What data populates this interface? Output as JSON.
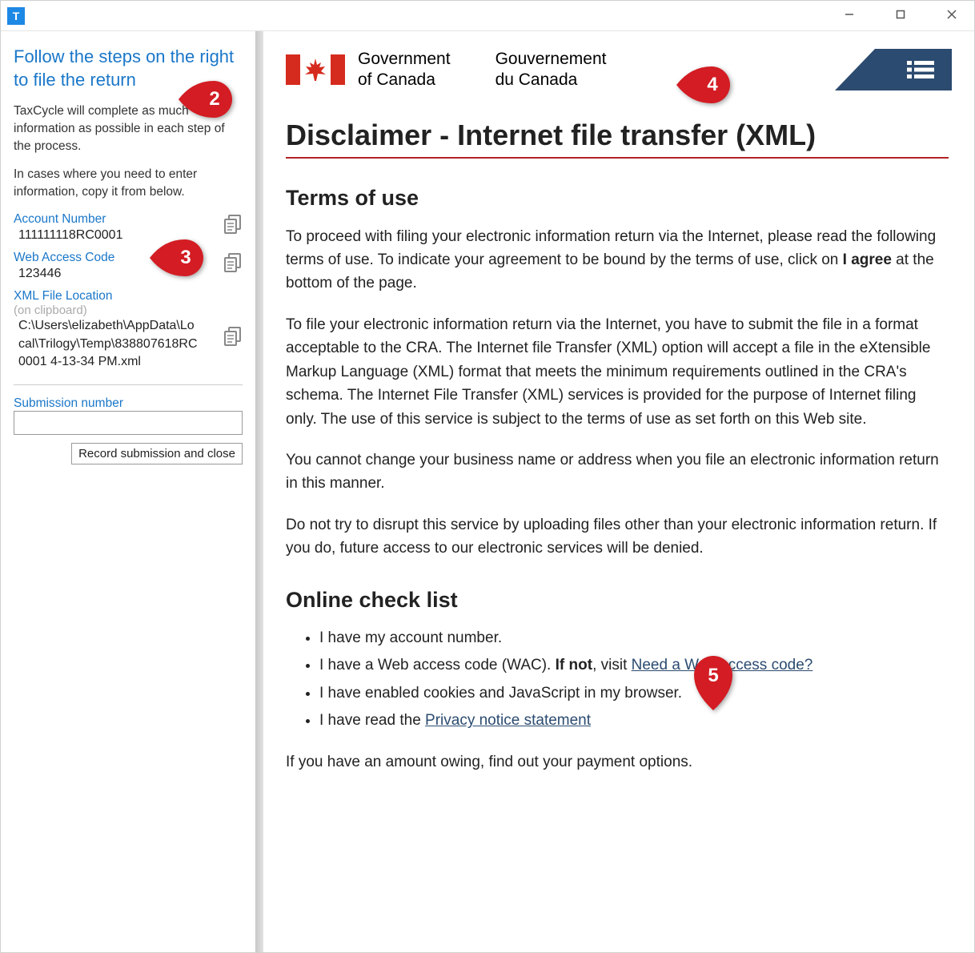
{
  "titlebar": {
    "icon_letter": "T"
  },
  "sidebar": {
    "heading": "Follow the steps on the right to file the return",
    "p1": "TaxCycle will complete as much information as possible in each step of the process.",
    "p2": "In cases where you need to enter information, copy it from below.",
    "account_label": "Account Number",
    "account_value": "111111118RC0001",
    "wac_label": "Web Access Code",
    "wac_value": "123446",
    "xml_label": "XML File Location",
    "xml_hint": "(on clipboard)",
    "xml_value": "C:\\Users\\elizabeth\\AppData\\Local\\Trilogy\\Temp\\838807618RC0001 4-13-34 PM.xml",
    "subnum_label": "Submission number",
    "record_btn": "Record submission and close"
  },
  "page": {
    "gov_en_l1": "Government",
    "gov_en_l2": "of Canada",
    "gov_fr_l1": "Gouvernement",
    "gov_fr_l2": "du Canada",
    "title": "Disclaimer - Internet file transfer (XML)",
    "terms_h": "Terms of use",
    "p1a": "To proceed with filing your electronic information return via the Internet, please read the following terms of use. To indicate your agreement to be bound by the terms of use, click on ",
    "p1b": "I agree",
    "p1c": " at the bottom of the page.",
    "p2": "To file your electronic information return via the Internet, you have to submit the file in a format acceptable to the CRA. The Internet file Transfer (XML) option will accept a file in the eXtensible Markup Language (XML) format that meets the minimum requirements outlined in the CRA's schema. The Internet File Transfer (XML) services is provided for the purpose of Internet filing only. The use of this service is subject to the terms of use as set forth on this Web site.",
    "p3": "You cannot change your business name or address when you file an electronic information return in this manner.",
    "p4": "Do not try to disrupt this service by uploading files other than your electronic information return. If you do, future access to our electronic services will be denied.",
    "check_h": "Online check list",
    "c1": "I have my account number.",
    "c2a": "I have a Web access code (WAC). ",
    "c2b": "If not",
    "c2c": ", visit ",
    "c2_link": "Need a Web access code?",
    "c3": "I have enabled cookies and JavaScript in my browser.",
    "c4a": "I have read the ",
    "c4_link": "Privacy notice statement",
    "last": "If you have an amount owing, find out your payment options."
  },
  "callouts": {
    "m2": "2",
    "m3": "3",
    "m4": "4",
    "m5": "5"
  }
}
